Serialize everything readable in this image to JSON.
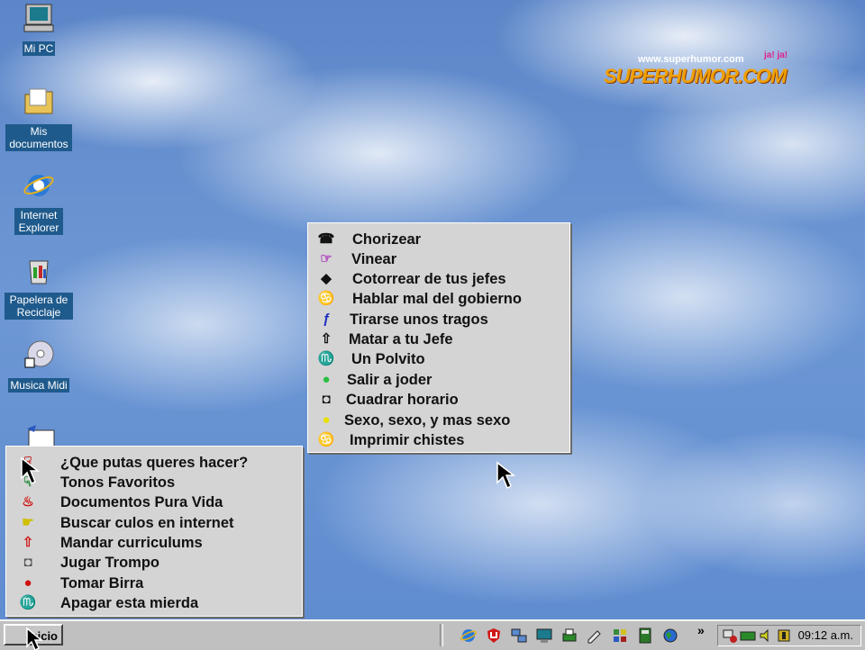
{
  "desktop_icons": [
    {
      "label": "Mi PC",
      "icon": "my-computer-icon"
    },
    {
      "label": "Mis documentos",
      "icon": "folder-icon"
    },
    {
      "label": "Internet Explorer",
      "icon": "internet-explorer-icon"
    },
    {
      "label": "Papelera de Reciclaje",
      "icon": "recycle-bin-icon"
    },
    {
      "label": "Musica Midi",
      "icon": "cd-audio-icon"
    }
  ],
  "logo": {
    "url_text": "www.superhumor.com",
    "laughs": "ja! ja!",
    "brand": "SUPERHUMOR.COM"
  },
  "popup_menu": {
    "items": [
      {
        "icon": "phone-icon",
        "label": "Chorizear"
      },
      {
        "icon": "pointing-hand-icon",
        "label": "Vinear"
      },
      {
        "icon": "diamond-icon",
        "label": "Cotorrear de tus jefes"
      },
      {
        "icon": "scroll-symbol-icon",
        "label": "Hablar mal del gobierno"
      },
      {
        "icon": "script-f-icon",
        "label": "Tirarse unos tragos"
      },
      {
        "icon": "up-arrow-outline-icon",
        "label": "Matar a tu Jefe"
      },
      {
        "icon": "m-glyph-icon",
        "label": "Un Polvito"
      },
      {
        "icon": "green-dot-icon",
        "label": "Salir a joder"
      },
      {
        "icon": "square-outline-icon",
        "label": "Cuadrar horario"
      },
      {
        "icon": "yellow-dot-icon",
        "label": "Sexo, sexo, y mas sexo"
      },
      {
        "icon": "cancer-sign-icon",
        "label": "Imprimir chistes"
      }
    ]
  },
  "start_menu": {
    "items": [
      {
        "icon": "hand-down-icon",
        "label": "¿Que putas queres hacer?"
      },
      {
        "icon": "hand-down-icon",
        "label": "Tonos Favoritos"
      },
      {
        "icon": "flame-icon",
        "label": "Documentos Pura Vida"
      },
      {
        "icon": "hand-point-icon",
        "label": "Buscar culos en internet"
      },
      {
        "icon": "up-arrow-outline-icon",
        "label": "Mandar curriculums"
      },
      {
        "icon": "square-outline-icon",
        "label": "Jugar Trompo"
      },
      {
        "icon": "red-dot-icon",
        "label": "Tomar Birra"
      },
      {
        "icon": "m-glyph-icon",
        "label": "Apagar esta mierda"
      }
    ]
  },
  "taskbar": {
    "start_label": "Inicio",
    "quicklaunch": [
      "internet-explorer-icon",
      "antivirus-icon",
      "network-icon",
      "monitor-icon",
      "printer-icon",
      "pencil-icon",
      "tools-icon",
      "book-icon",
      "globe-icon"
    ],
    "chevron": "»",
    "clock": "09:12 a.m."
  },
  "colors": {
    "desktop_sky": "#6d97d4",
    "menu_bg": "#d4d4d4",
    "taskbar": "#c0c0c0",
    "icon_label_bg": "#1f5a8c"
  }
}
